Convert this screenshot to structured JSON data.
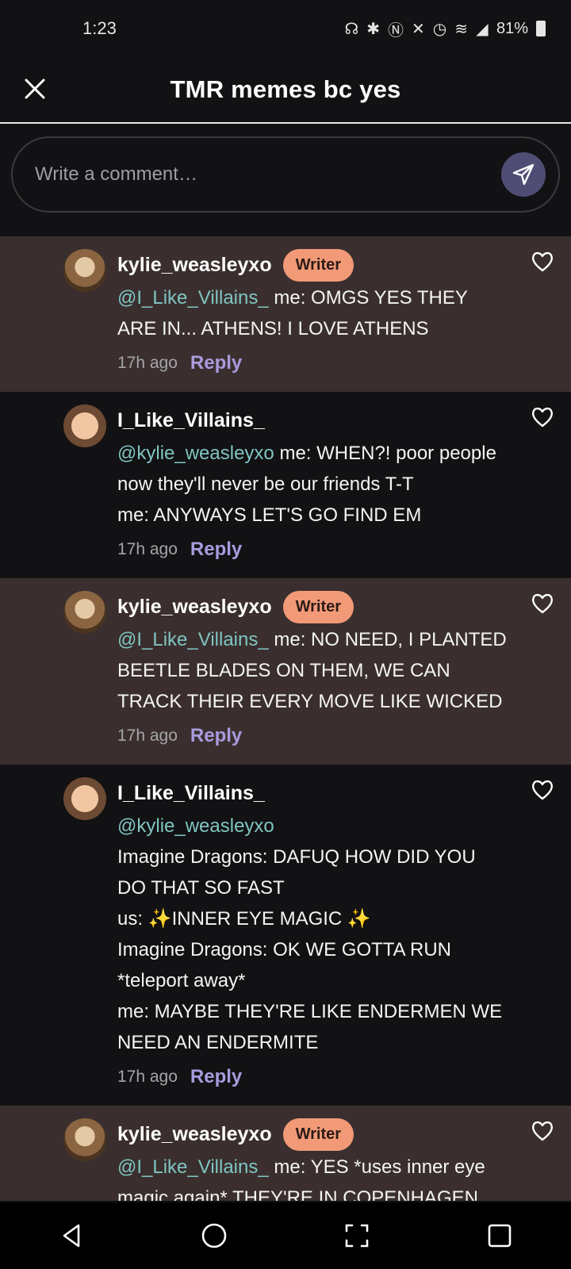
{
  "status_bar": {
    "time": "1:23",
    "battery": "81%",
    "icons": [
      "headphones-icon",
      "bluetooth-icon",
      "nfc-icon",
      "mute-icon",
      "alarm-icon",
      "wifi-icon",
      "signal-icon",
      "battery-icon"
    ]
  },
  "header": {
    "title": "TMR memes bc yes",
    "close_icon": "close-icon"
  },
  "composer": {
    "placeholder": "Write a comment…",
    "send_icon": "send-icon"
  },
  "comments": [
    {
      "username": "kylie_weasleyxo",
      "badge": "Writer",
      "mention": "@I_Like_Villains_",
      "lines": [
        "me: OMGS YES THEY ARE IN... ATHENS! I LOVE ATHENS"
      ],
      "time": "17h ago",
      "reply": "Reply"
    },
    {
      "username": "I_Like_Villains_",
      "badge": "",
      "mention": "@kylie_weasleyxo",
      "lines": [
        "me: WHEN?! poor people now they'll never be our friends T-T",
        "me: ANYWAYS LET'S GO FIND EM"
      ],
      "time": "17h ago",
      "reply": "Reply"
    },
    {
      "username": "kylie_weasleyxo",
      "badge": "Writer",
      "mention": "@I_Like_Villains_",
      "lines": [
        "me: NO NEED, I PLANTED BEETLE BLADES ON THEM, WE CAN TRACK THEIR EVERY MOVE LIKE WICKED"
      ],
      "time": "17h ago",
      "reply": "Reply"
    },
    {
      "username": "I_Like_Villains_",
      "badge": "",
      "mention": "@kylie_weasleyxo",
      "lines": [
        "Imagine Dragons: DAFUQ HOW DID YOU DO THAT SO FAST",
        "us: ✨INNER EYE MAGIC ✨",
        "Imagine Dragons: OK WE GOTTA RUN *teleport away*",
        "me: MAYBE THEY'RE LIKE ENDERMEN WE NEED AN ENDERMITE"
      ],
      "time": "17h ago",
      "reply": "Reply"
    },
    {
      "username": "kylie_weasleyxo",
      "badge": "Writer",
      "mention": "@I_Like_Villains_",
      "lines": [
        "me: YES *uses inner eye magic again* THEY'RE IN COPENHAGEN WTF"
      ],
      "time": "",
      "reply": ""
    }
  ],
  "nav": {
    "back": "back-icon",
    "home": "home-icon",
    "screenshot": "screenshot-icon",
    "recents": "recents-icon"
  }
}
